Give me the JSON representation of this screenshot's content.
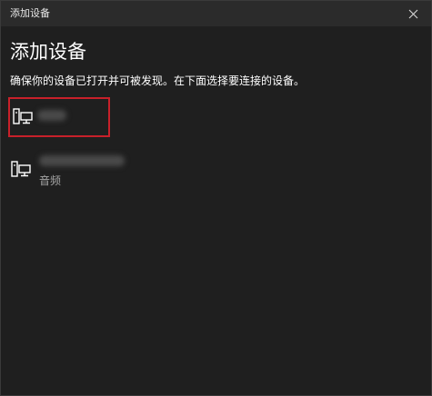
{
  "window": {
    "title": "添加设备"
  },
  "header": {
    "title": "添加设备",
    "instructions": "确保你的设备已打开并可被发现。在下面选择要连接的设备。"
  },
  "devices": [
    {
      "name": "",
      "subtitle": "",
      "icon": "device-monitor-icon",
      "selected": true
    },
    {
      "name": "",
      "subtitle": "音频",
      "icon": "device-monitor-icon",
      "selected": false
    }
  ],
  "colors": {
    "background": "#1f1f1f",
    "titlebar": "#2b2b2b",
    "selection_outline": "#c8202a",
    "secondary_text": "#a6a6a6"
  }
}
